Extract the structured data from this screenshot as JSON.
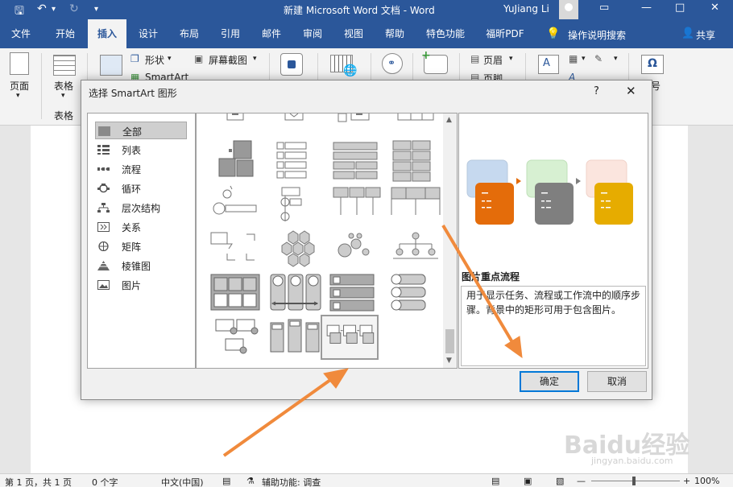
{
  "window": {
    "title": "新建 Microsoft Word 文档 - Word",
    "user": "YuJiang Li"
  },
  "tabs": [
    "文件",
    "开始",
    "插入",
    "设计",
    "布局",
    "引用",
    "邮件",
    "审阅",
    "视图",
    "帮助",
    "特色功能",
    "福昕PDF"
  ],
  "active_tab": "插入",
  "tell_me": "操作说明搜索",
  "share": "共享",
  "ribbon": {
    "page": "页面",
    "table": "表格",
    "table_group": "表格",
    "shapes": "形状",
    "smartart": "SmartArt",
    "screenshot": "屏幕截图",
    "header": "页眉",
    "footer": "页脚",
    "symbol": "号"
  },
  "dialog": {
    "title": "选择 SmartArt 图形",
    "help": "?",
    "categories": [
      {
        "label": "全部",
        "icon": "all-icon"
      },
      {
        "label": "列表",
        "icon": "list-icon"
      },
      {
        "label": "流程",
        "icon": "process-icon"
      },
      {
        "label": "循环",
        "icon": "cycle-icon"
      },
      {
        "label": "层次结构",
        "icon": "hierarchy-icon"
      },
      {
        "label": "关系",
        "icon": "relationship-icon"
      },
      {
        "label": "矩阵",
        "icon": "matrix-icon"
      },
      {
        "label": "棱锥图",
        "icon": "pyramid-icon"
      },
      {
        "label": "图片",
        "icon": "picture-icon"
      }
    ],
    "active_category": "全部",
    "preview_name": "图片重点流程",
    "preview_description": "用于显示任务、流程或工作流中的顺序步骤。背景中的矩形可用于包含图片。",
    "ok": "确定",
    "cancel": "取消"
  },
  "status": {
    "page": "第 1 页，共 1 页",
    "words": "0 个字",
    "language": "中文(中国)",
    "accessibility": "辅助功能: 调查",
    "zoom": "100%"
  },
  "colors": {
    "brand": "#2b579a",
    "arrow": "#f08a3c",
    "preview_orange": "#e46c0a",
    "preview_gray": "#7f7f7f",
    "preview_gold": "#e6ac00"
  },
  "watermark": {
    "brand": "Baidu",
    "brand_cn": "经验",
    "url": "jingyan.baidu.com"
  }
}
